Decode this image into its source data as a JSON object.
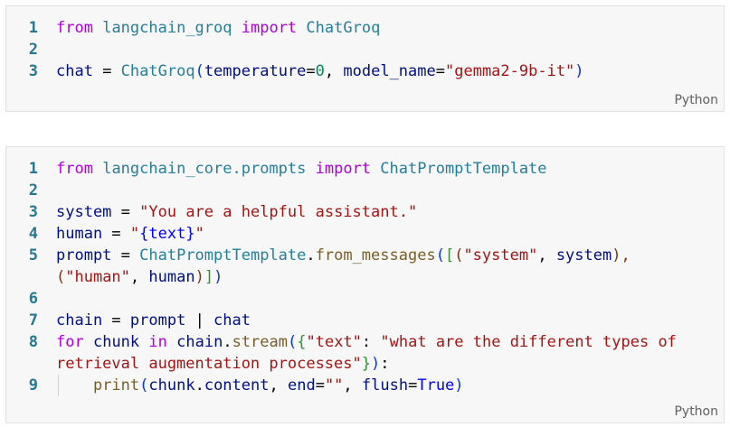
{
  "cells": [
    {
      "language_label": "Python",
      "lines": [
        {
          "number": "1",
          "tokens": [
            {
              "t": "from",
              "c": "kw"
            },
            {
              "t": " ",
              "c": "op"
            },
            {
              "t": "langchain_groq",
              "c": "mod"
            },
            {
              "t": " ",
              "c": "op"
            },
            {
              "t": "import",
              "c": "kw"
            },
            {
              "t": " ",
              "c": "op"
            },
            {
              "t": "ChatGroq",
              "c": "cls"
            }
          ]
        },
        {
          "number": "2",
          "tokens": []
        },
        {
          "number": "3",
          "tokens": [
            {
              "t": "chat",
              "c": "var"
            },
            {
              "t": " = ",
              "c": "op"
            },
            {
              "t": "ChatGroq",
              "c": "cls"
            },
            {
              "t": "(",
              "c": "b1"
            },
            {
              "t": "temperature",
              "c": "var"
            },
            {
              "t": "=",
              "c": "op"
            },
            {
              "t": "0",
              "c": "num"
            },
            {
              "t": ", ",
              "c": "op"
            },
            {
              "t": "model_name",
              "c": "var"
            },
            {
              "t": "=",
              "c": "op"
            },
            {
              "t": "\"gemma2-9b-it\"",
              "c": "str"
            },
            {
              "t": ")",
              "c": "b1"
            }
          ]
        }
      ]
    },
    {
      "language_label": "Python",
      "lines": [
        {
          "number": "1",
          "tokens": [
            {
              "t": "from",
              "c": "kw"
            },
            {
              "t": " ",
              "c": "op"
            },
            {
              "t": "langchain_core.prompts",
              "c": "mod"
            },
            {
              "t": " ",
              "c": "op"
            },
            {
              "t": "import",
              "c": "kw"
            },
            {
              "t": " ",
              "c": "op"
            },
            {
              "t": "ChatPromptTemplate",
              "c": "cls"
            }
          ]
        },
        {
          "number": "2",
          "tokens": []
        },
        {
          "number": "3",
          "tokens": [
            {
              "t": "system",
              "c": "var"
            },
            {
              "t": " = ",
              "c": "op"
            },
            {
              "t": "\"You are a helpful assistant.\"",
              "c": "str"
            }
          ]
        },
        {
          "number": "4",
          "tokens": [
            {
              "t": "human",
              "c": "var"
            },
            {
              "t": " = ",
              "c": "op"
            },
            {
              "t": "\"",
              "c": "str"
            },
            {
              "t": "{text}",
              "c": "const"
            },
            {
              "t": "\"",
              "c": "str"
            }
          ]
        },
        {
          "number": "5",
          "tokens": [
            {
              "t": "prompt",
              "c": "var"
            },
            {
              "t": " = ",
              "c": "op"
            },
            {
              "t": "ChatPromptTemplate",
              "c": "cls"
            },
            {
              "t": ".",
              "c": "op"
            },
            {
              "t": "from_messages",
              "c": "fn"
            },
            {
              "t": "(",
              "c": "b1"
            },
            {
              "t": "[",
              "c": "b2"
            },
            {
              "t": "(",
              "c": "b3"
            },
            {
              "t": "\"system\"",
              "c": "str"
            },
            {
              "t": ", ",
              "c": "op"
            },
            {
              "t": "system",
              "c": "var"
            },
            {
              "t": "),",
              "c": "b3"
            }
          ]
        },
        {
          "number": "",
          "tokens": [
            {
              "t": "(",
              "c": "b3"
            },
            {
              "t": "\"human\"",
              "c": "str"
            },
            {
              "t": ", ",
              "c": "op"
            },
            {
              "t": "human",
              "c": "var"
            },
            {
              "t": ")",
              "c": "b3"
            },
            {
              "t": "]",
              "c": "b2"
            },
            {
              "t": ")",
              "c": "b1"
            }
          ]
        },
        {
          "number": "6",
          "tokens": []
        },
        {
          "number": "7",
          "tokens": [
            {
              "t": "chain",
              "c": "var"
            },
            {
              "t": " = ",
              "c": "op"
            },
            {
              "t": "prompt",
              "c": "var"
            },
            {
              "t": " | ",
              "c": "op"
            },
            {
              "t": "chat",
              "c": "var"
            }
          ]
        },
        {
          "number": "8",
          "tokens": [
            {
              "t": "for",
              "c": "kw"
            },
            {
              "t": " ",
              "c": "op"
            },
            {
              "t": "chunk",
              "c": "var"
            },
            {
              "t": " ",
              "c": "op"
            },
            {
              "t": "in",
              "c": "kw"
            },
            {
              "t": " ",
              "c": "op"
            },
            {
              "t": "chain",
              "c": "var"
            },
            {
              "t": ".",
              "c": "op"
            },
            {
              "t": "stream",
              "c": "fn"
            },
            {
              "t": "(",
              "c": "b1"
            },
            {
              "t": "{",
              "c": "b2"
            },
            {
              "t": "\"text\"",
              "c": "str"
            },
            {
              "t": ": ",
              "c": "op"
            },
            {
              "t": "\"what are the different types of",
              "c": "str"
            }
          ]
        },
        {
          "number": "",
          "tokens": [
            {
              "t": "retrieval augmentation processes\"",
              "c": "str"
            },
            {
              "t": "}",
              "c": "b2"
            },
            {
              "t": ")",
              "c": "b1"
            },
            {
              "t": ":",
              "c": "op"
            }
          ]
        },
        {
          "number": "9",
          "indent": true,
          "tokens": [
            {
              "t": "    ",
              "c": "op"
            },
            {
              "t": "print",
              "c": "fn"
            },
            {
              "t": "(",
              "c": "b1"
            },
            {
              "t": "chunk",
              "c": "var"
            },
            {
              "t": ".",
              "c": "op"
            },
            {
              "t": "content",
              "c": "var"
            },
            {
              "t": ", ",
              "c": "op"
            },
            {
              "t": "end",
              "c": "var"
            },
            {
              "t": "=",
              "c": "op"
            },
            {
              "t": "\"\"",
              "c": "str"
            },
            {
              "t": ", ",
              "c": "op"
            },
            {
              "t": "flush",
              "c": "var"
            },
            {
              "t": "=",
              "c": "op"
            },
            {
              "t": "True",
              "c": "const"
            },
            {
              "t": ")",
              "c": "b1"
            }
          ]
        }
      ]
    }
  ]
}
